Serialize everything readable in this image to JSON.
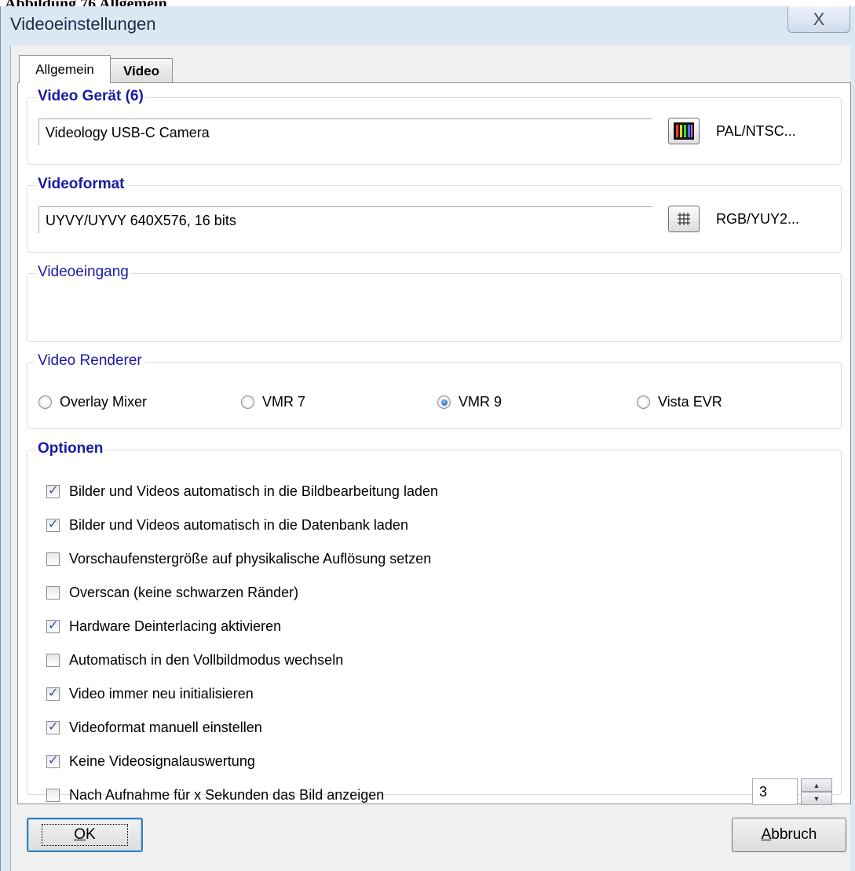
{
  "caption": "Abbildung 76 Allgemein",
  "window": {
    "title": "Videoeinstellungen",
    "close_glyph": "X"
  },
  "tabs": [
    {
      "label": "Allgemein",
      "active": true
    },
    {
      "label": "Video",
      "active": false
    }
  ],
  "video_device": {
    "legend": "Video Gerät (6)",
    "value": "Videology USB-C Camera",
    "button_icon": "color-bars-icon",
    "side_label": "PAL/NTSC..."
  },
  "video_format": {
    "legend": "Videoformat",
    "value": "UYVY/UYVY 640X576, 16 bits",
    "button_icon": "grid-icon",
    "side_label": "RGB/YUY2..."
  },
  "video_input": {
    "legend": "Videoeingang"
  },
  "renderer": {
    "legend": "Video Renderer",
    "options": [
      {
        "label": "Overlay Mixer",
        "selected": false
      },
      {
        "label": "VMR 7",
        "selected": false
      },
      {
        "label": "VMR 9",
        "selected": true
      },
      {
        "label": "Vista EVR",
        "selected": false
      }
    ]
  },
  "options": {
    "legend": "Optionen",
    "items": [
      {
        "label": "Bilder und Videos automatisch in die Bildbearbeitung laden",
        "checked": true
      },
      {
        "label": "Bilder und Videos automatisch in die Datenbank laden",
        "checked": true
      },
      {
        "label": "Vorschaufenstergröße auf physikalische Auflösung setzen",
        "checked": false
      },
      {
        "label": "Overscan (keine schwarzen Ränder)",
        "checked": false
      },
      {
        "label": "Hardware Deinterlacing aktivieren",
        "checked": true
      },
      {
        "label": "Automatisch in den Vollbildmodus wechseln",
        "checked": false
      },
      {
        "label": "Video immer neu initialisieren",
        "checked": true
      },
      {
        "label": "Videoformat manuell einstellen",
        "checked": true
      },
      {
        "label": "Keine Videosignalauswertung",
        "checked": true
      },
      {
        "label": "Nach Aufnahme für x Sekunden das Bild anzeigen",
        "checked": false
      }
    ],
    "seconds_value": "3"
  },
  "buttons": {
    "ok_mnemonic": "O",
    "ok_rest": "K",
    "cancel_mnemonic": "A",
    "cancel_rest": "bbruch"
  },
  "colors": {
    "group_title": "#1a1aa8",
    "title_bar": "#dce7f4",
    "dialog_bg": "#f0f0f0",
    "checkmark": "#3c4fa8"
  }
}
